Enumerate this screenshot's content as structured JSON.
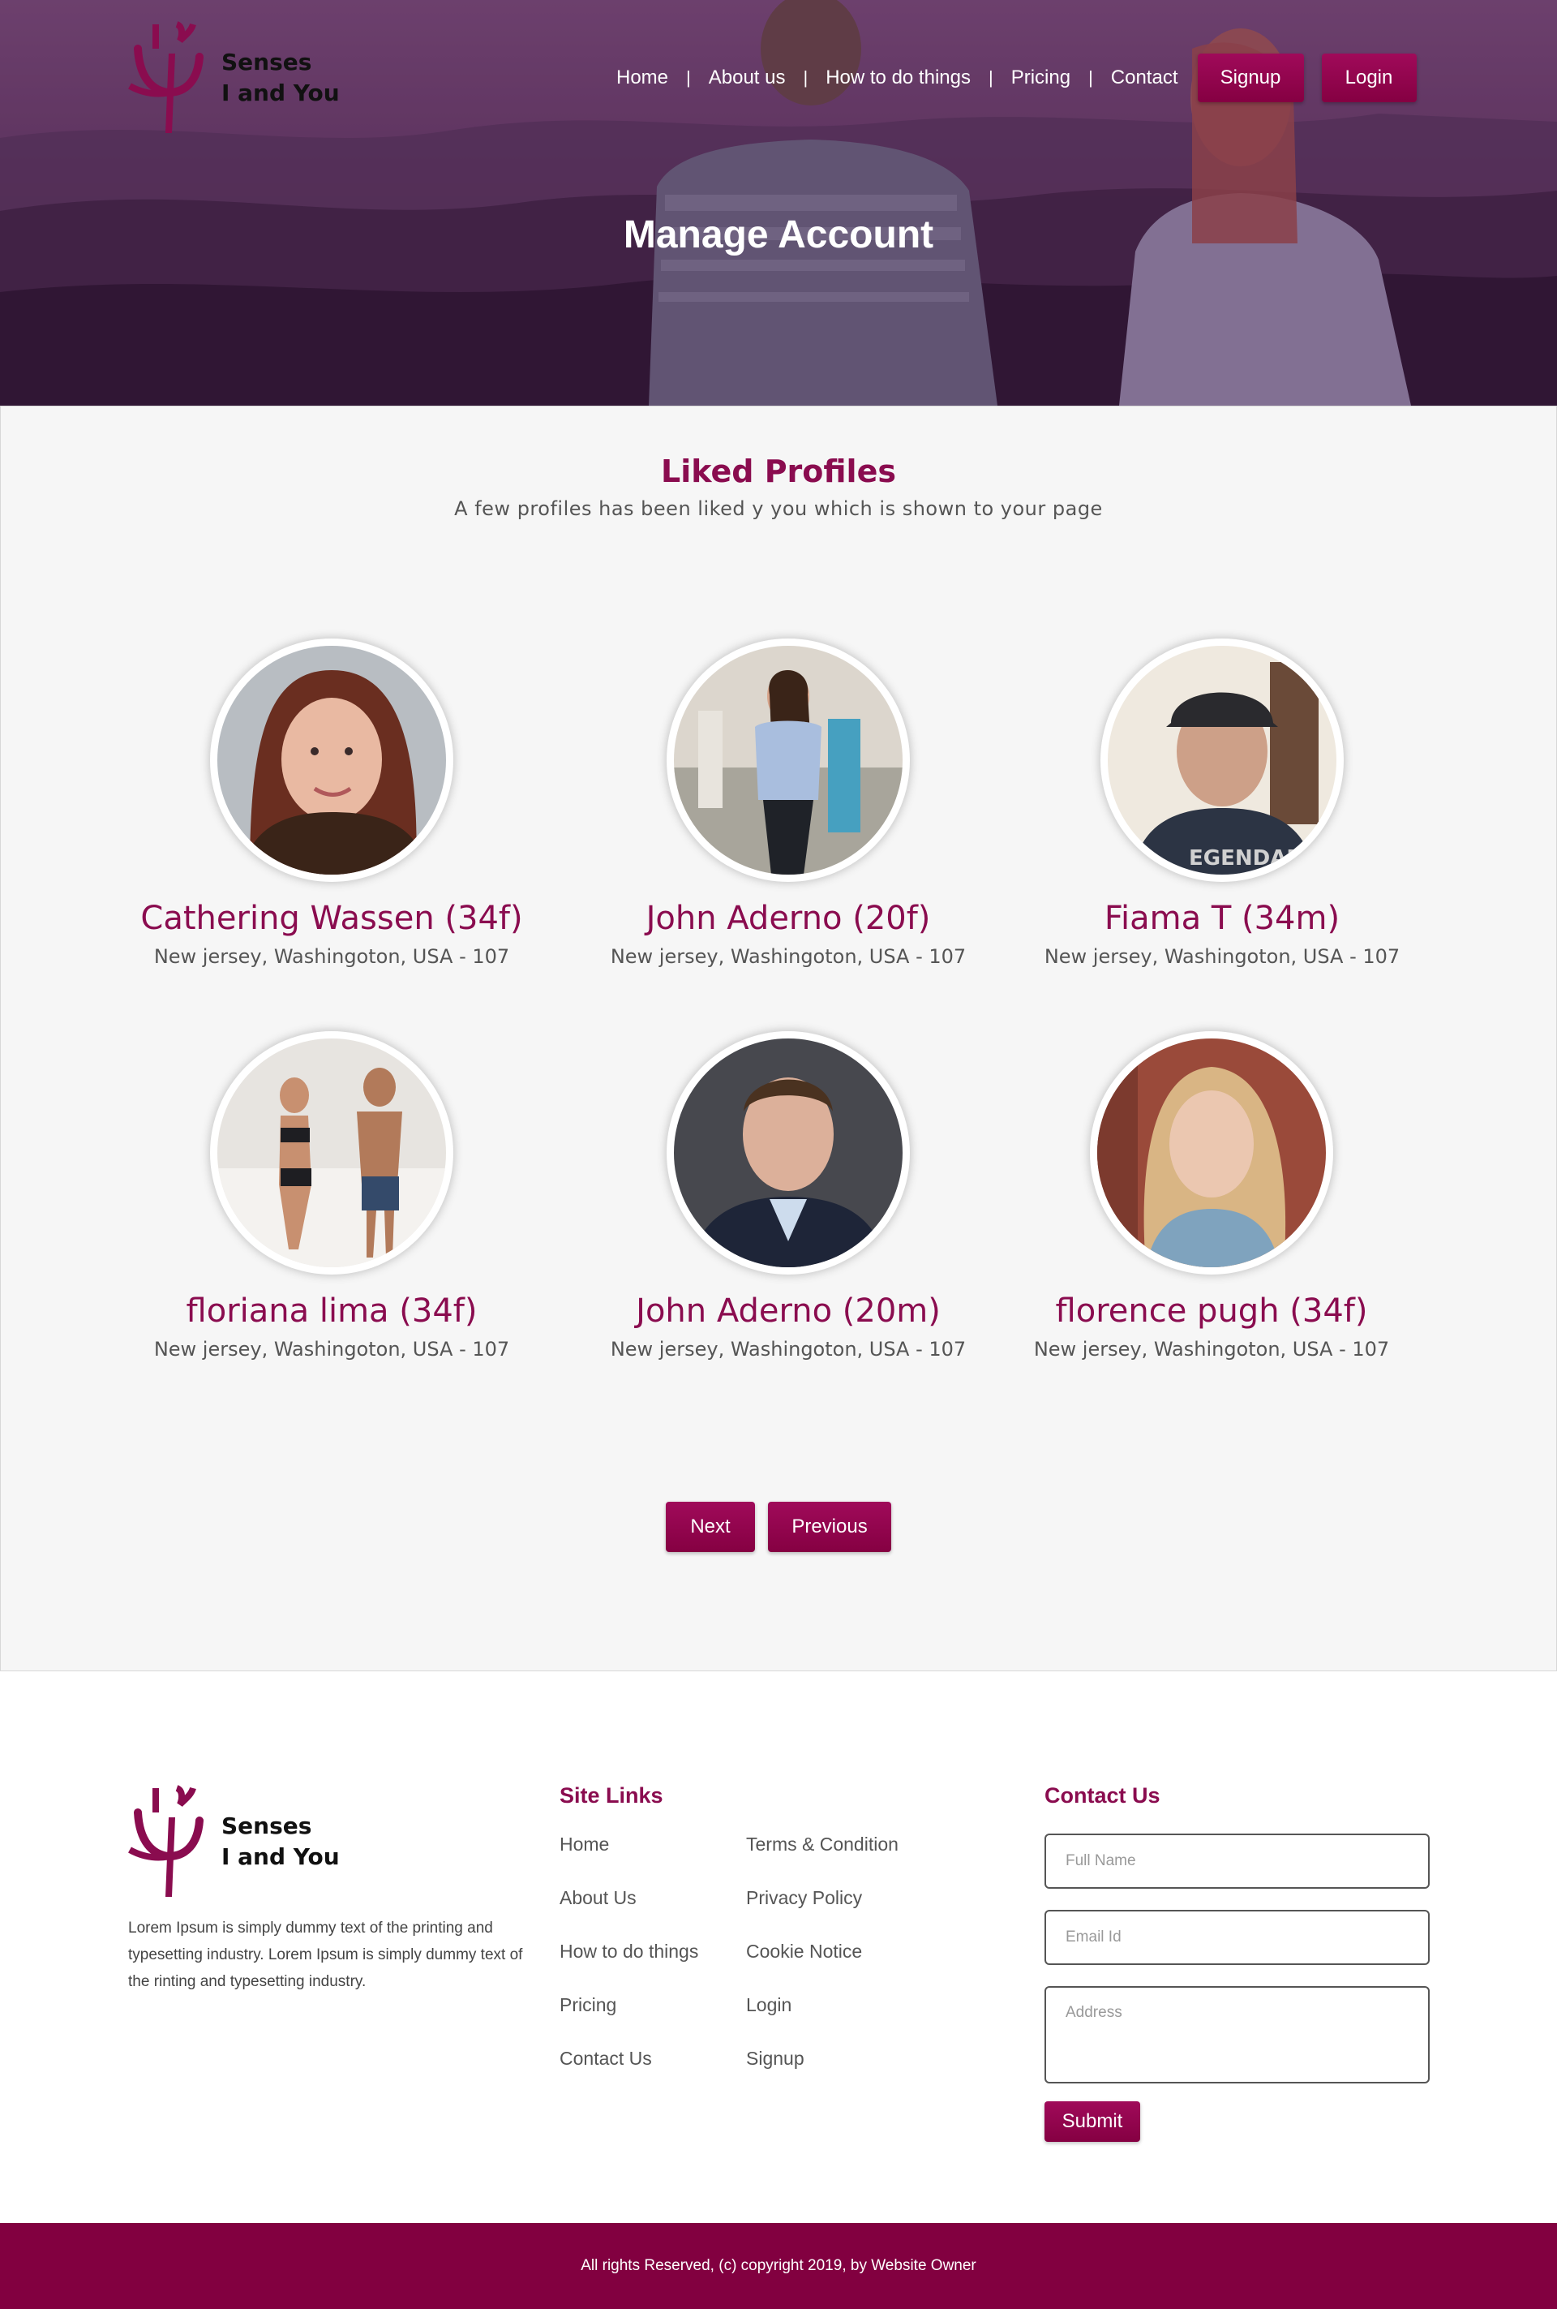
{
  "brand": {
    "name_line1": "Senses",
    "name_line2": "I and You",
    "color": "#8a0c4f"
  },
  "nav": {
    "items": [
      "Home",
      "About us",
      "How to do things",
      "Pricing",
      "Contact"
    ],
    "signup": "Signup",
    "login": "Login"
  },
  "hero": {
    "title": "Manage Account"
  },
  "liked": {
    "title": "Liked Profiles",
    "subtitle": "A few profiles has been liked y you which is shown to your page",
    "profiles": [
      {
        "name": "Cathering Wassen (34f)",
        "location": "New jersey, Washingoton, USA - 107"
      },
      {
        "name": "John Aderno (20f)",
        "location": "New jersey, Washingoton, USA - 107"
      },
      {
        "name": "Fiama T (34m)",
        "location": "New jersey, Washingoton, USA - 107"
      },
      {
        "name": "floriana lima (34f)",
        "location": "New jersey, Washingoton, USA - 107"
      },
      {
        "name": "John Aderno (20m)",
        "location": "New jersey, Washingoton, USA - 107"
      },
      {
        "name": "florence pugh (34f)",
        "location": "New jersey, Washingoton, USA - 107"
      }
    ],
    "next": "Next",
    "previous": "Previous"
  },
  "footer": {
    "about": "Lorem Ipsum is simply dummy text of the  printing and typesetting industry. Lorem  Ipsum is simply dummy text of the   rinting and typesetting industry.",
    "site_links_title": "Site Links",
    "links_col1": [
      "Home",
      "About Us",
      "How to do things",
      "Pricing",
      "Contact Us"
    ],
    "links_col2": [
      "Terms & Condition",
      "Privacy Policy",
      "Cookie Notice",
      "Login",
      "Signup"
    ],
    "contact_title": "Contact Us",
    "full_name_placeholder": "Full Name",
    "email_placeholder": "Email Id",
    "address_placeholder": "Address",
    "submit": "Submit",
    "copyright": "All rights Reserved, (c) copyright 2019, by Website Owner"
  }
}
